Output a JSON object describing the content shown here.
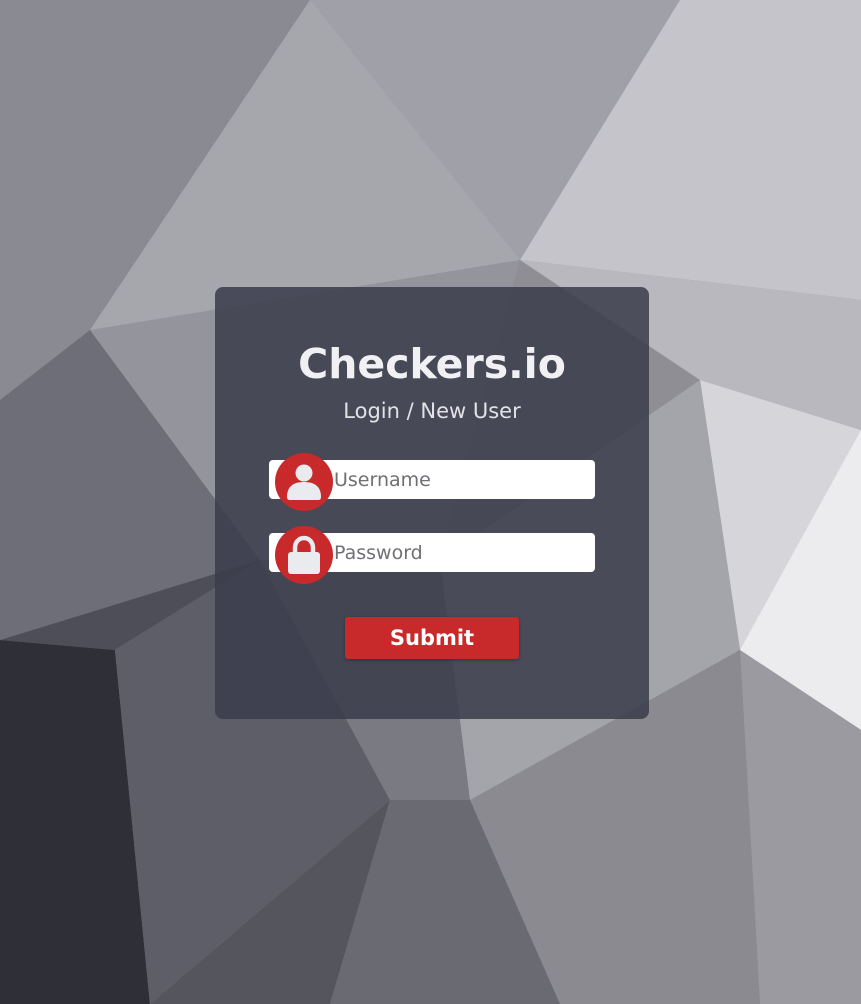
{
  "app": {
    "title": "Checkers.io",
    "subtitle": "Login / New User"
  },
  "form": {
    "username": {
      "value": "",
      "placeholder": "Username",
      "icon": "user-icon"
    },
    "password": {
      "value": "",
      "placeholder": "Password",
      "icon": "lock-icon"
    },
    "submit_label": "Submit"
  },
  "colors": {
    "accent": "#c8292a",
    "card_background": "#3a3c4c",
    "icon_fill": "#e9ebef",
    "text": "#f1f1f4"
  }
}
